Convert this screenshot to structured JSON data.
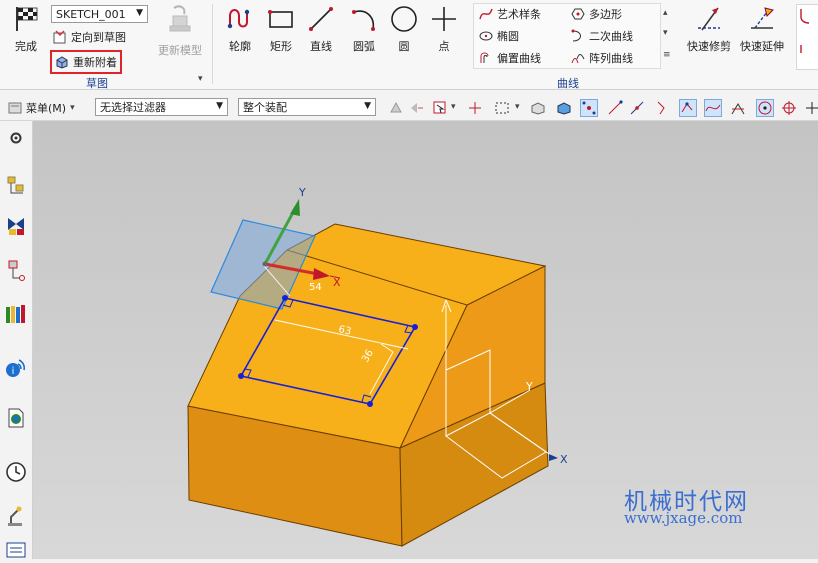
{
  "ribbon": {
    "finish_label": "完成",
    "sketch_name": "SKETCH_001",
    "orient_label": "定向到草图",
    "reattach_label": "重新附着",
    "update_model_label": "更新模型",
    "sketch_group_label": "草图",
    "curve_group_label": "曲线",
    "tools": [
      {
        "key": "profile",
        "label": "轮廓"
      },
      {
        "key": "rectangle",
        "label": "矩形"
      },
      {
        "key": "line",
        "label": "直线"
      },
      {
        "key": "arc",
        "label": "圆弧"
      },
      {
        "key": "circle",
        "label": "圆"
      },
      {
        "key": "point",
        "label": "点"
      }
    ],
    "curve_small": {
      "studio_spline": "艺术样条",
      "polygon": "多边形",
      "ellipse": "椭圆",
      "conic": "二次曲线",
      "offset_curve": "偏置曲线",
      "pattern_curve": "阵列曲线"
    },
    "quick_trim_label": "快速修剪",
    "quick_extend_label": "快速延伸"
  },
  "toolbar": {
    "menu_label": "菜单(M)",
    "filter_value": "无选择过滤器",
    "assembly_value": "整个装配"
  },
  "viewport": {
    "axis_labels": {
      "y1": "Y",
      "x1": "X",
      "y2": "Y",
      "x2": "X"
    },
    "dimensions": {
      "d1": "63",
      "d2": "36",
      "d3": "54"
    }
  },
  "watermark": {
    "line1": "机械时代网",
    "line2": "www.jxage.com"
  },
  "colors": {
    "accent": "#1a3f8b",
    "highlight_box": "#e0242a",
    "part_face": "#f5a623",
    "sketch": "#1520d8"
  }
}
